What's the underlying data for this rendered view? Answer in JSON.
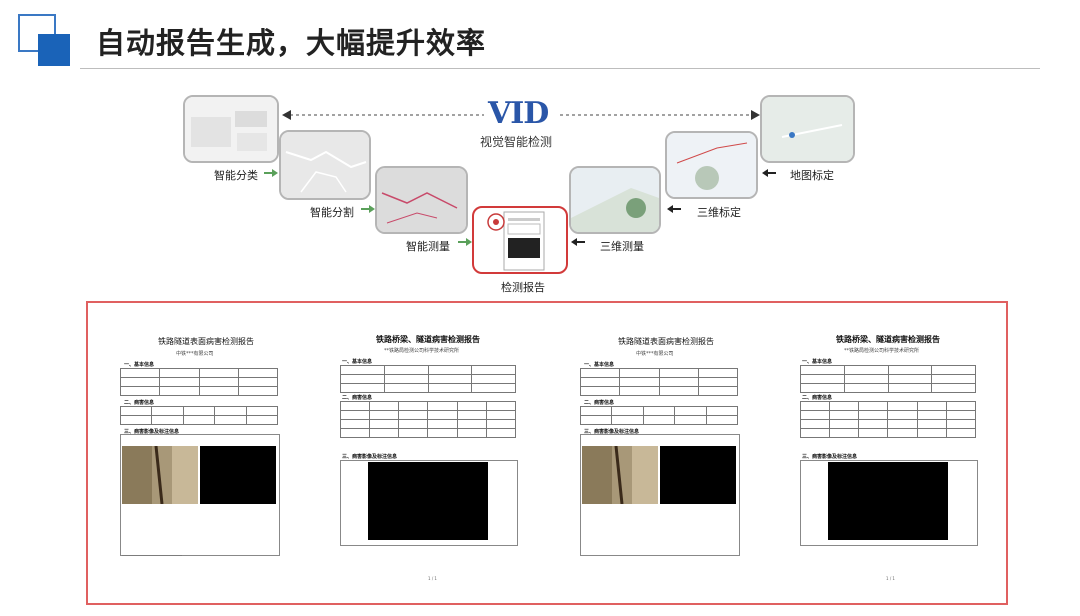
{
  "header": {
    "title": "自动报告生成，大幅提升效率"
  },
  "logo": {
    "main": "VID",
    "sub": "视觉智能检测"
  },
  "flow": {
    "steps": [
      {
        "id": "classify",
        "label": "智能分类"
      },
      {
        "id": "segment",
        "label": "智能分割"
      },
      {
        "id": "measure",
        "label": "智能测量"
      },
      {
        "id": "report",
        "label": "检测报告"
      },
      {
        "id": "measure3d",
        "label": "三维测量"
      },
      {
        "id": "calib3d",
        "label": "三维标定"
      },
      {
        "id": "mapcalib",
        "label": "地图标定"
      }
    ]
  },
  "reports": {
    "pages": [
      {
        "title": "铁路隧道表面病害检测报告",
        "sub": "中铁***有限公司",
        "section1": "一、基本信息",
        "section2": "二、病害信息",
        "section3": "三、病害影像及标注信息"
      },
      {
        "title": "铁路桥梁、隧道病害检测报告",
        "sub": "**铁路局检测公司科学技术研究所",
        "section1": "一、基本信息",
        "section2": "二、病害信息",
        "section3": "三、病害影像及标注信息",
        "page": "1 / 1"
      },
      {
        "title": "铁路隧道表面病害检测报告",
        "sub": "中铁***有限公司",
        "section1": "一、基本信息",
        "section2": "二、病害信息",
        "section3": "三、病害影像及标注信息"
      },
      {
        "title": "铁路桥梁、隧道病害检测报告",
        "sub": "**铁路局检测公司科学技术研究所",
        "section1": "一、基本信息",
        "section2": "二、病害信息",
        "section3": "三、病害影像及标注信息",
        "page": "1 / 1"
      }
    ]
  },
  "colors": {
    "brand": "#1a63b8",
    "green_arrow": "#5aa05a",
    "highlight": "#d23a3a"
  }
}
